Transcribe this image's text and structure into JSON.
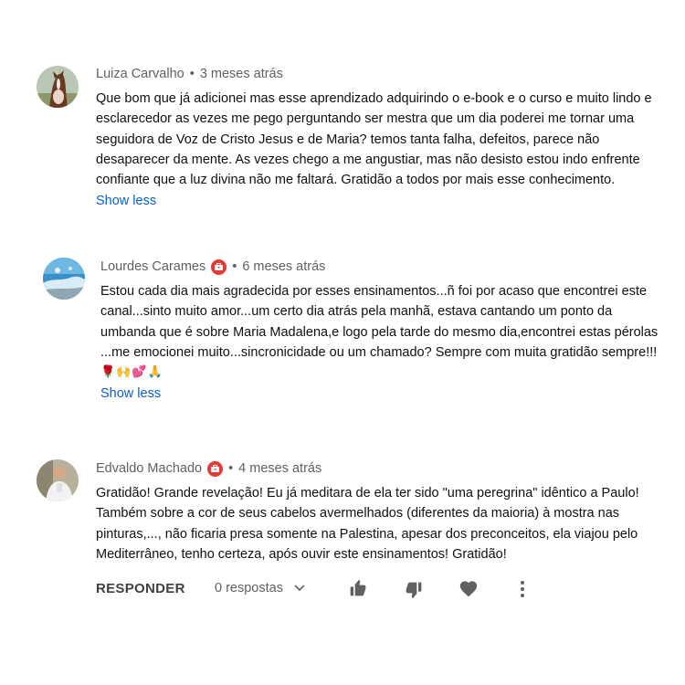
{
  "comments": [
    {
      "author": "Luiza Carvalho",
      "time": "3 meses atrás",
      "lines": [
        "Que bom que já adicionei mas esse aprendizado adquirindo o e-book e o curso e muito lindo e",
        "esclarecedor as vezes me pego perguntando ser mestra que um dia poderei me tornar uma",
        "seguidora de Voz de Cristo Jesus e de Maria? temos tanta falha, defeitos, parece não",
        "desaparecer da mente. As vezes chego a me angustiar, mas não desisto estou indo enfrente",
        "confiante que a luz divina não me faltará. Gratidão a todos por mais esse conhecimento."
      ],
      "show_less": "Show less"
    },
    {
      "author": "Lourdes Carames",
      "time": "6 meses atrás",
      "lines": [
        "Estou cada dia mais agradecida por esses ensinamentos...ñ foi por acaso que encontrei este",
        "canal...sinto muito amor...um certo dia atrás pela manhã, estava cantando um ponto da",
        "umbanda que é sobre Maria Madalena,e logo pela tarde do mesmo dia,encontrei estas pérolas",
        "...me emocionei muito...sincronicidade ou um chamado? Sempre com muita gratidão sempre!!!"
      ],
      "emoji_line": "🌹🙌💕🙏",
      "show_less": "Show less"
    },
    {
      "author": "Edvaldo Machado",
      "time": "4 meses atrás",
      "lines": [
        "Gratidão! Grande revelação! Eu já meditara de ela ter sido \"uma peregrina\" idêntico a Paulo!",
        "Também sobre a cor de seus cabelos avermelhados (diferentes da maioria) à mostra nas",
        "pinturas,..., não ficaria presa somente na Palestina, apesar dos preconceitos, ela viajou pelo",
        "Mediterrâneo, tenho certeza, após ouvir este ensinamentos! Gratidão!"
      ]
    }
  ],
  "actions": {
    "reply_label": "RESPONDER",
    "replies_label": "0 respostas",
    "icons": [
      "like-icon",
      "dislike-icon",
      "heart-icon",
      "more-vert-icon"
    ]
  },
  "colors": {
    "meta": "#606060",
    "link": "#065fd4",
    "badge": "#e53935",
    "icon": "#606060"
  }
}
